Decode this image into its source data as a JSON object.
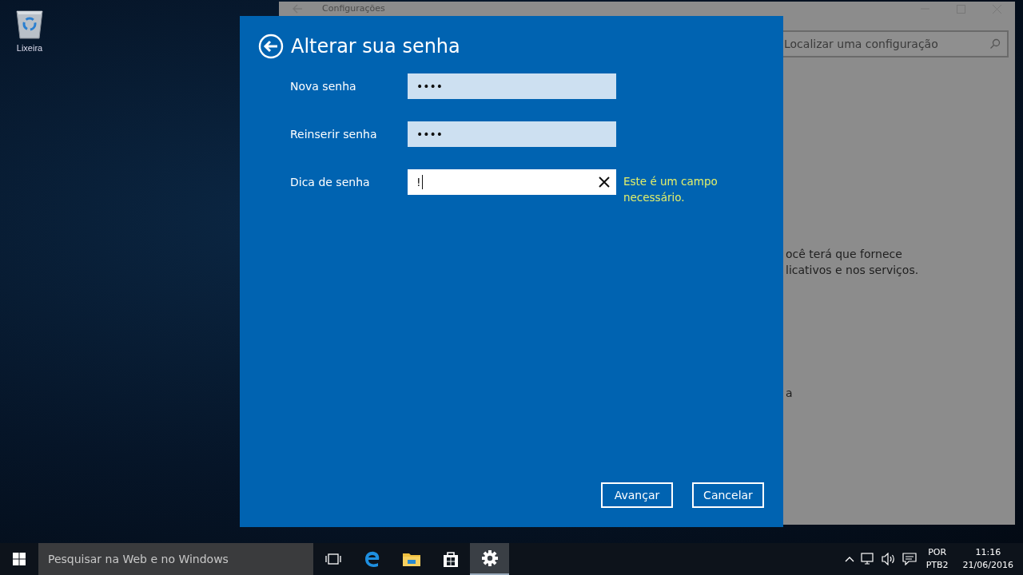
{
  "desktop_icons": [
    {
      "label": "Lixeira"
    }
  ],
  "background_window": {
    "title": "Configurações",
    "search": {
      "placeholder": "Localizar uma configuração"
    },
    "text_lines": [
      "ocê terá que fornece",
      "licativos e nos serviços.",
      "a"
    ]
  },
  "dialog": {
    "title": "Alterar sua senha",
    "fields": [
      {
        "label": "Nova senha",
        "kind": "password",
        "value": "••••",
        "focused": false
      },
      {
        "label": "Reinserir senha",
        "kind": "password",
        "value": "••••",
        "focused": false
      },
      {
        "label": "Dica de senha",
        "kind": "text",
        "value": "!",
        "focused": true,
        "error": "Este é um campo necessário."
      }
    ],
    "buttons": [
      {
        "label": "Avançar"
      },
      {
        "label": "Cancelar"
      }
    ]
  },
  "taskbar": {
    "search": {
      "placeholder": "Pesquisar na Web e no Windows"
    },
    "apps": [
      {
        "kind": "task-view",
        "selected": false
      },
      {
        "kind": "browser",
        "selected": false
      },
      {
        "kind": "folder",
        "selected": false
      },
      {
        "kind": "store",
        "selected": false
      },
      {
        "kind": "settings",
        "selected": true
      }
    ],
    "tray": {
      "language": "POR",
      "layout": "PTB2",
      "time": "11:16",
      "date": "21/06/2016"
    }
  }
}
